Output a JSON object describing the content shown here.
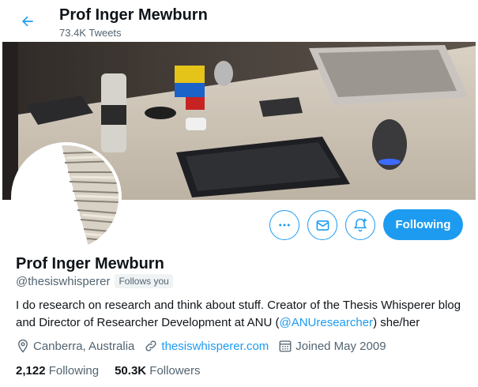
{
  "header": {
    "name": "Prof Inger Mewburn",
    "tweet_count": "73.4K Tweets"
  },
  "profile": {
    "name": "Prof Inger Mewburn",
    "handle": "@thesiswhisperer",
    "follows_you": "Follows you",
    "bio_before": "I do research on research and think about stuff. Creator of the Thesis Whisperer blog and Director of Researcher Development at ANU (",
    "bio_mention": "@ANUresearcher",
    "bio_after": ") she/her",
    "location": "Canberra, Australia",
    "website": "thesiswhisperer.com",
    "joined": "Joined May 2009"
  },
  "actions": {
    "following_label": "Following"
  },
  "stats": {
    "following_count": "2,122",
    "following_label": "Following",
    "followers_count": "50.3K",
    "followers_label": "Followers"
  },
  "colors": {
    "accent": "#1d9bf0",
    "secondary_text": "#536471"
  },
  "icons": [
    "arrow-left-icon",
    "more-icon",
    "mail-icon",
    "bell-plus-icon",
    "location-icon",
    "link-icon",
    "calendar-icon"
  ]
}
